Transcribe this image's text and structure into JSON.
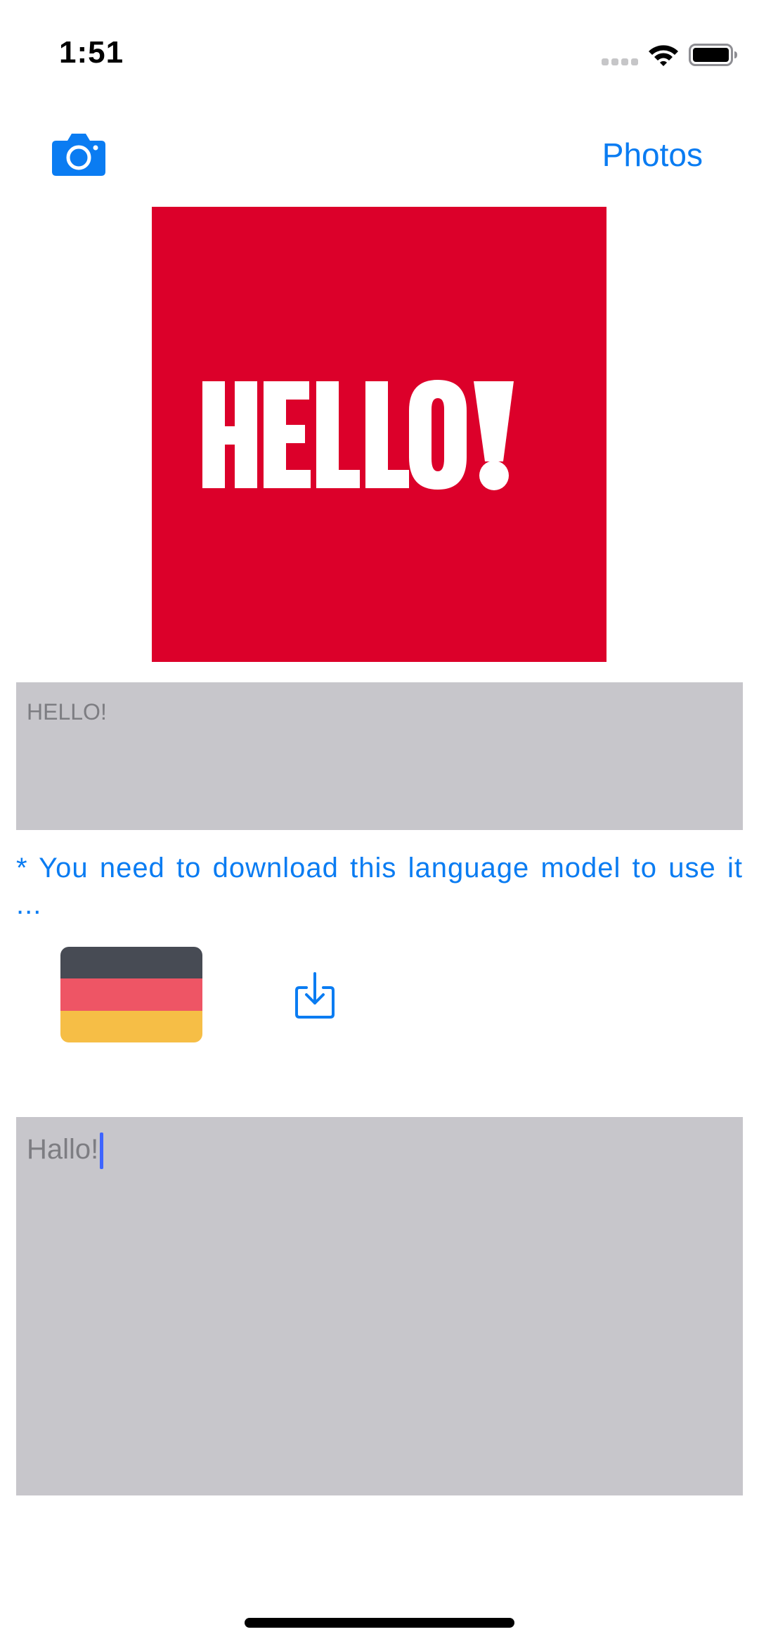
{
  "status_bar": {
    "time": "1:51"
  },
  "nav": {
    "photos_label": "Photos",
    "camera_icon": "camera-icon"
  },
  "logo_image": {
    "text": "HELLO!",
    "background": "#dc002a",
    "text_color": "#ffffff"
  },
  "source_text": {
    "value": "HELLO!"
  },
  "notice": {
    "text": "* You need to download this language model to use it ..."
  },
  "language": {
    "flag": "germany-flag",
    "colors": [
      "#474b54",
      "#ee5565",
      "#f6be46"
    ],
    "download_icon": "download-icon"
  },
  "target_text": {
    "value": "Hallo!"
  },
  "colors": {
    "accent": "#0a7cf2",
    "box_bg": "#c7c6cb"
  }
}
